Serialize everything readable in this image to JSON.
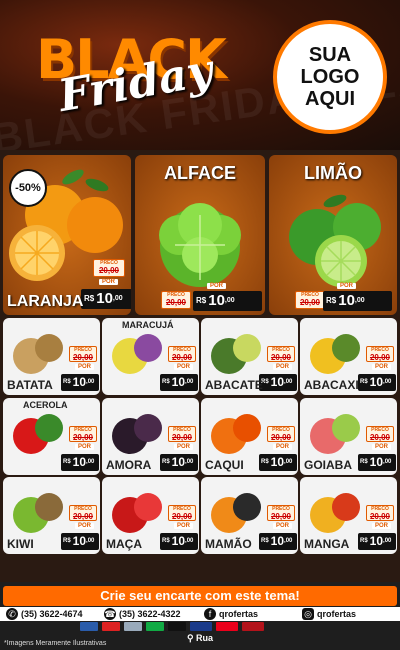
{
  "header": {
    "black": "BLACK",
    "friday": "Friday",
    "bg_text": "BLACK FRIDAY BLACK",
    "logo_lines": [
      "SUA",
      "LOGO",
      "AQUI"
    ]
  },
  "colors": {
    "accent": "#ff6a00",
    "dark": "#111111"
  },
  "featured": [
    {
      "name": "LARANJA",
      "title_position": "bottom",
      "badge": "-50%",
      "preco_label": "PRECO",
      "old_price": "20,00",
      "por": "POR",
      "currency": "R$",
      "price": "10",
      "cents": ",00",
      "unit": "KG",
      "fruit_icon": "orange-fruit-icon"
    },
    {
      "name": "ALFACE",
      "title_position": "top",
      "preco_label": "PRECO",
      "old_price": "20,00",
      "por": "POR",
      "currency": "R$",
      "price": "10",
      "cents": ",00",
      "unit": "UNID",
      "fruit_icon": "lettuce-icon"
    },
    {
      "name": "LIMÃO",
      "title_position": "top",
      "preco_label": "PRECO",
      "old_price": "20,00",
      "por": "POR",
      "currency": "R$",
      "price": "10",
      "cents": ",00",
      "unit": "KG",
      "fruit_icon": "lime-icon"
    }
  ],
  "products": [
    {
      "name": "BATATA",
      "extra": "",
      "old_price": "20,00",
      "price": "10",
      "cents": ",00",
      "icon": "potato-icon"
    },
    {
      "name": "",
      "extra": "MARACUJÁ",
      "old_price": "20,00",
      "price": "10",
      "cents": ",00",
      "icon": "passion-fruit-icon"
    },
    {
      "name": "ABACATE",
      "extra": "",
      "old_price": "20,00",
      "price": "10",
      "cents": ",00",
      "icon": "avocado-icon"
    },
    {
      "name": "ABACAXI",
      "extra": "",
      "old_price": "20,00",
      "price": "10",
      "cents": ",00",
      "icon": "pineapple-icon"
    },
    {
      "name": "",
      "extra": "ACEROLA",
      "old_price": "20,00",
      "price": "10",
      "cents": ",00",
      "icon": "acerola-icon"
    },
    {
      "name": "AMORA",
      "extra": "",
      "old_price": "20,00",
      "price": "10",
      "cents": ",00",
      "icon": "blackberry-icon"
    },
    {
      "name": "CAQUI",
      "extra": "",
      "old_price": "20,00",
      "price": "10",
      "cents": ",00",
      "icon": "persimmon-icon"
    },
    {
      "name": "GOIABA",
      "extra": "",
      "old_price": "20,00",
      "price": "10",
      "cents": ",00",
      "icon": "guava-icon"
    },
    {
      "name": "KIWI",
      "extra": "",
      "old_price": "20,00",
      "price": "10",
      "cents": ",00",
      "icon": "kiwi-icon"
    },
    {
      "name": "MAÇA",
      "extra": "",
      "old_price": "20,00",
      "price": "10",
      "cents": ",00",
      "icon": "apple-icon"
    },
    {
      "name": "MAMÃO",
      "extra": "",
      "old_price": "20,00",
      "price": "10",
      "cents": ",00",
      "icon": "papaya-icon"
    },
    {
      "name": "MANGA",
      "extra": "",
      "old_price": "20,00",
      "price": "10",
      "cents": ",00",
      "icon": "mango-icon"
    }
  ],
  "labels": {
    "preco": "PRECO",
    "por": "POR",
    "currency": "R$"
  },
  "footer": {
    "cta": "Crie seu encarte com este tema!",
    "phone1_label": "Telefone",
    "phone1": "(35) 3622-4674",
    "phone2_label": "Telefone",
    "phone2": "(35) 3622-4322",
    "facebook": "qrofertas",
    "instagram": "qrofertas",
    "address": "Rua",
    "disclaimer": "*Imagens Meramente Ilustrativas"
  }
}
